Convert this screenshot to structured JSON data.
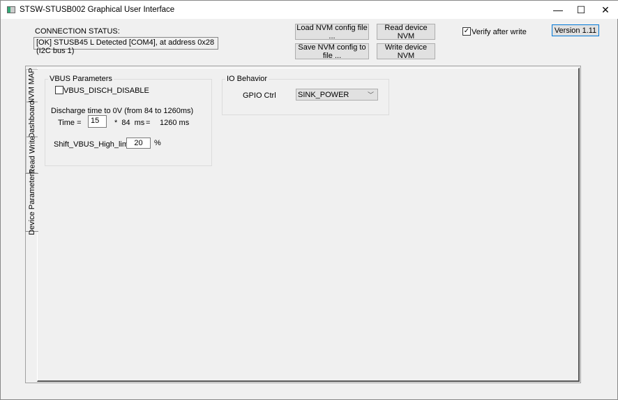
{
  "window": {
    "title": "STSW-STUSB002 Graphical User Interface",
    "minimize": "—",
    "maximize": "☐",
    "close": "✕"
  },
  "connection": {
    "label": "CONNECTION STATUS:",
    "value": "[OK]  STUSB45 L Detected [COM4], at address 0x28 (I2C bus 1)"
  },
  "toolbar": {
    "load": "Load NVM config file ...",
    "save": "Save NVM config to file ...",
    "read": "Read device NVM",
    "write": "Write device NVM",
    "verify_label": "Verify after write",
    "verify_checked": true,
    "version": "Version 1.11"
  },
  "tabs": [
    {
      "label": "NVM MAP"
    },
    {
      "label": "Dashboard"
    },
    {
      "label": "Read Write"
    },
    {
      "label": "Device Parameters",
      "selected": true
    }
  ],
  "vbus": {
    "title": "VBUS Parameters",
    "disch_disable_label": "VBUS_DISCH_DISABLE",
    "disch_disable_checked": false,
    "discharge_label": "Discharge time to 0V (from 84 to 1260ms)",
    "time_label": "Time =",
    "time_value": "15",
    "multiplier": "*  84 ms",
    "equals": "=",
    "result": "1260 ms",
    "shift_label": "Shift_VBUS_High_limit",
    "shift_value": "20",
    "shift_unit": "%"
  },
  "io": {
    "title": "IO Behavior",
    "gpio_label": "GPIO Ctrl",
    "gpio_value": "SINK_POWER"
  }
}
